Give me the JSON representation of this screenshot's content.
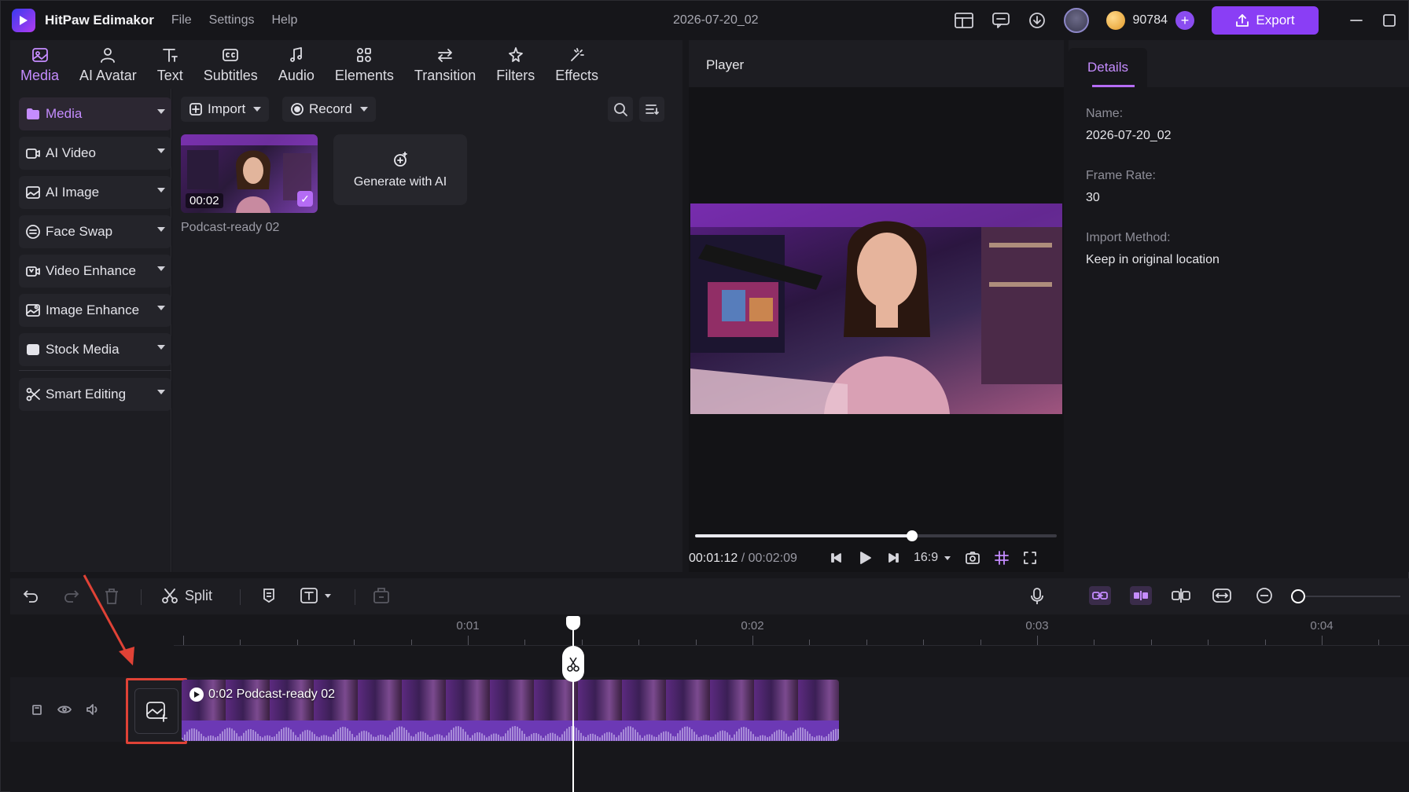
{
  "app": {
    "name": "HitPaw Edimakor",
    "menu": [
      "File",
      "Settings",
      "Help"
    ],
    "project_title": "2026-07-20_02",
    "coins": "90784",
    "export_label": "Export"
  },
  "topnav": [
    {
      "label": "Media",
      "icon": "media-icon",
      "active": true
    },
    {
      "label": "AI Avatar",
      "icon": "ai-avatar-icon"
    },
    {
      "label": "Text",
      "icon": "text-icon"
    },
    {
      "label": "Subtitles",
      "icon": "subtitles-icon"
    },
    {
      "label": "Audio",
      "icon": "audio-icon"
    },
    {
      "label": "Elements",
      "icon": "elements-icon"
    },
    {
      "label": "Transition",
      "icon": "transition-icon"
    },
    {
      "label": "Filters",
      "icon": "filters-icon"
    },
    {
      "label": "Effects",
      "icon": "effects-icon"
    }
  ],
  "sidebar": {
    "items": [
      {
        "label": "Media",
        "active": true
      },
      {
        "label": "AI Video"
      },
      {
        "label": "AI Image"
      },
      {
        "label": "Face Swap"
      },
      {
        "label": "Video Enhance"
      },
      {
        "label": "Image Enhance"
      },
      {
        "label": "Stock Media"
      },
      {
        "label": "Smart Editing"
      }
    ]
  },
  "media": {
    "import_label": "Import",
    "record_label": "Record",
    "clip": {
      "duration": "00:02",
      "name": "Podcast-ready 02",
      "selected": true
    },
    "generate_label": "Generate with AI"
  },
  "player": {
    "title": "Player",
    "current_time": "00:01:12",
    "separator": " / ",
    "total_time": "00:02:09",
    "progress": 0.6,
    "aspect": "16:9"
  },
  "details": {
    "tab": "Details",
    "fields": [
      {
        "label": "Name:",
        "value": "2026-07-20_02"
      },
      {
        "label": "Frame Rate:",
        "value": "30"
      },
      {
        "label": "Import Method:",
        "value": "Keep in original location"
      }
    ]
  },
  "timeline": {
    "split_label": "Split",
    "ruler_labels": [
      "0:01",
      "0:02",
      "0:03",
      "0:04"
    ],
    "clip_label": "0:02 Podcast-ready 02",
    "accent": "#b56cf5",
    "highlight_color": "#e04236"
  }
}
